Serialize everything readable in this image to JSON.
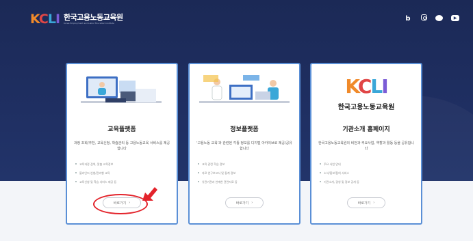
{
  "header": {
    "logo_mark": [
      "K",
      "C",
      "L",
      "I"
    ],
    "logo_name": "한국고용노동교육원",
    "logo_sub": "Korea Employment and Labor Education Institute",
    "social": [
      "blog-icon",
      "instagram-icon",
      "chat-icon",
      "youtube-icon"
    ]
  },
  "cards": [
    {
      "title": "교육플랫폼",
      "desc": "과정 조회/추천, 교육신청, 학습관리 등 고용노동교육 서비스를 제공합니다",
      "items": [
        "교육과정 검색, 맞춤 교육정보",
        "블라인드/신청/관리형 교육",
        "교육신청 및 학습 서비스 제공 등"
      ],
      "button": "바로가기"
    },
    {
      "title": "정보플랫폼",
      "desc": "'고용노동 교육'과 관련된 각종 정보를 디지털 아카이브로 제공/공유합니다",
      "items": [
        "교육 관련 학습 정보",
        "자료 연구보고서 및 통계 정보",
        "유관기관과 연계한 관련자료 등"
      ],
      "button": "바로가기"
    },
    {
      "title": "기관소개 홈페이지",
      "desc": "한국고용노동교육원의 비전과 주요사업, 역할과 활동 등을 공유합니다",
      "items": [
        "주요 사업 안내",
        "소식/홍보/참여 서비스",
        "기관소개, 경영 및 정보 공개 등"
      ],
      "button": "바로가기"
    }
  ],
  "colors": {
    "hero": "#1f2f62",
    "card_border": "#5a8fd6",
    "highlight": "#e3232b"
  }
}
